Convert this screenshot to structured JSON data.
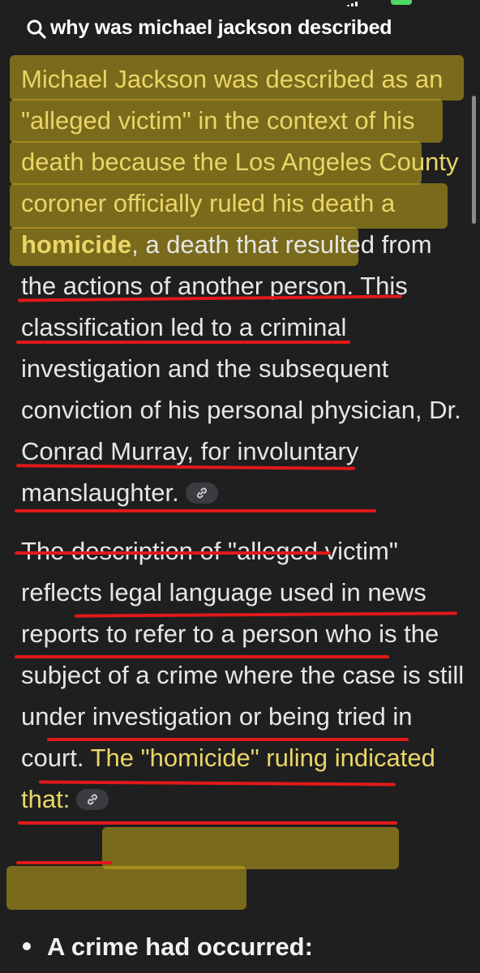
{
  "search": {
    "query": "why was michael jackson described"
  },
  "answer": {
    "p1_yellow_1": "Michael Jackson was described as an \"alleged victim\" in the context of his death because the Los Angeles County coroner officially ruled his death a ",
    "p1_bold": "homicide",
    "p1_rest": ", a death that resulted from the actions of another person. This classification led to a criminal investigation and the subsequent conviction of his personal physician, Dr. Conrad Murray, for involuntary manslaughter.",
    "p2_white": "The description of \"alleged victim\" reflects legal language used in news reports to refer to a person who is the subject of a crime where the case is still under investigation or being tried in court. ",
    "p2_yellow": "The \"homicide\" ruling indicated that:",
    "bullet_1": "A crime had occurred:"
  },
  "colors": {
    "background": "#1f1f1f",
    "highlight": "#c4a81a",
    "underline": "#e0191a",
    "highlight_text": "#ead667"
  },
  "icons": [
    "search-icon",
    "link-icon"
  ]
}
